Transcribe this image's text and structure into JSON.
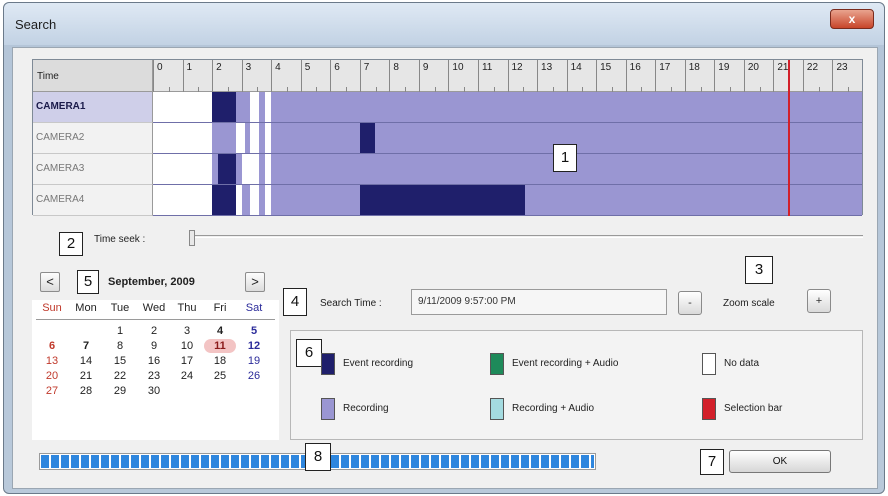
{
  "window": {
    "title": "Search",
    "close_glyph": "x"
  },
  "timeline": {
    "header_label": "Time",
    "hours": [
      "0",
      "1",
      "2",
      "3",
      "4",
      "5",
      "6",
      "7",
      "8",
      "9",
      "10",
      "11",
      "12",
      "13",
      "14",
      "15",
      "16",
      "17",
      "18",
      "19",
      "20",
      "21",
      "22",
      "23"
    ],
    "selection_hour": 21.5,
    "cameras": [
      {
        "name": "CAMERA1",
        "active": true,
        "segments": [
          [
            2.0,
            2.8,
            "event"
          ],
          [
            2.8,
            3.0,
            "recording"
          ],
          [
            3.0,
            3.3,
            "recording"
          ],
          [
            3.6,
            3.8,
            "recording"
          ],
          [
            4.0,
            24.0,
            "recording"
          ]
        ]
      },
      {
        "name": "CAMERA2",
        "active": false,
        "segments": [
          [
            2.0,
            2.8,
            "recording"
          ],
          [
            3.1,
            3.3,
            "recording"
          ],
          [
            3.6,
            3.8,
            "recording"
          ],
          [
            4.0,
            7.0,
            "recording"
          ],
          [
            7.0,
            7.5,
            "event"
          ],
          [
            7.5,
            24.0,
            "recording"
          ]
        ]
      },
      {
        "name": "CAMERA3",
        "active": false,
        "segments": [
          [
            2.0,
            2.2,
            "recording"
          ],
          [
            2.2,
            2.8,
            "event"
          ],
          [
            2.8,
            3.0,
            "recording"
          ],
          [
            3.6,
            3.8,
            "recording"
          ],
          [
            4.0,
            24.0,
            "recording"
          ]
        ]
      },
      {
        "name": "CAMERA4",
        "active": false,
        "segments": [
          [
            2.0,
            2.2,
            "event"
          ],
          [
            2.2,
            2.8,
            "event"
          ],
          [
            3.0,
            3.3,
            "recording"
          ],
          [
            3.6,
            3.8,
            "recording"
          ],
          [
            4.0,
            7.0,
            "recording"
          ],
          [
            7.0,
            12.6,
            "event"
          ],
          [
            12.6,
            24.0,
            "recording"
          ]
        ]
      }
    ]
  },
  "time_seek": {
    "label": "Time seek :",
    "position_fraction": 0.0
  },
  "calendar": {
    "title": "September, 2009",
    "prev_glyph": "<",
    "next_glyph": ">",
    "weekdays": [
      "Sun",
      "Mon",
      "Tue",
      "Wed",
      "Thu",
      "Fri",
      "Sat"
    ],
    "first_weekday_index": 2,
    "days": [
      "1",
      "2",
      "3",
      "4",
      "5",
      "6",
      "7",
      "8",
      "9",
      "10",
      "11",
      "12",
      "13",
      "14",
      "15",
      "16",
      "17",
      "18",
      "19",
      "20",
      "21",
      "22",
      "23",
      "24",
      "25",
      "26",
      "27",
      "28",
      "29",
      "30"
    ],
    "bold_days": [
      "4",
      "5",
      "6",
      "7",
      "11",
      "12"
    ],
    "selected_day": "11"
  },
  "search": {
    "label": "Search Time :",
    "value": "9/11/2009 9:57:00 PM",
    "zoom_out_label": "-",
    "zoom_label": "Zoom scale",
    "zoom_in_label": "+"
  },
  "legend": [
    {
      "label": "Event recording",
      "color": "#1f1f6b"
    },
    {
      "label": "Event recording + Audio",
      "color": "#1e8a5a"
    },
    {
      "label": "No data",
      "color": "#ffffff"
    },
    {
      "label": "Recording",
      "color": "#9a96d2"
    },
    {
      "label": "Recording + Audio",
      "color": "#a4dbe0"
    },
    {
      "label": "Selection bar",
      "color": "#d2202a"
    }
  ],
  "progress": {
    "fraction": 1.0
  },
  "ok_label": "OK",
  "callouts": [
    "1",
    "2",
    "3",
    "4",
    "5",
    "6",
    "7",
    "8"
  ],
  "colors": {
    "event": "#1f1f6b",
    "recording": "#9a96d2",
    "selection": "#d2202a"
  }
}
